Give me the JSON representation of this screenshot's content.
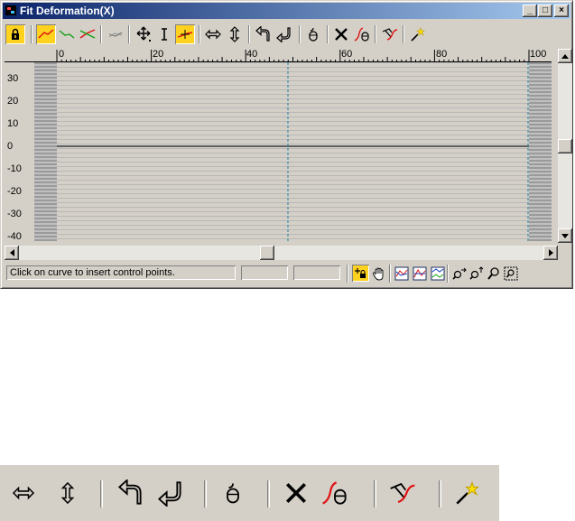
{
  "window": {
    "title": "Fit Deformation(X)",
    "controls": {
      "minimize": "_",
      "maximize": "□",
      "close": "×"
    }
  },
  "toolbar": {
    "items": [
      {
        "icon": "lock-aspect-icon",
        "active": true
      },
      {
        "icon": "display-x-axis-icon"
      },
      {
        "icon": "display-y-axis-icon"
      },
      {
        "icon": "display-xy-axes-icon"
      },
      {
        "icon": "swap-deform-curves-icon"
      },
      {
        "icon": "move-control-point-icon"
      },
      {
        "icon": "scale-control-point-icon"
      },
      {
        "icon": "insert-bezier-point-icon",
        "active": true
      },
      {
        "icon": "mirror-horizontally-icon"
      },
      {
        "icon": "mirror-vertically-icon"
      },
      {
        "icon": "rotate-90-ccw-icon"
      },
      {
        "icon": "rotate-90-cw-icon"
      },
      {
        "icon": "delete-control-point-icon"
      },
      {
        "icon": "reset-curve-icon"
      },
      {
        "icon": "delete-curve-icon"
      },
      {
        "icon": "get-shape-icon"
      },
      {
        "icon": "generate-path-icon"
      }
    ]
  },
  "graph": {
    "ruler_labels": [
      "0",
      "20",
      "40",
      "60",
      "80",
      "100"
    ],
    "y_labels": [
      "30",
      "20",
      "10",
      "0",
      "-10",
      "-20",
      "-30",
      "-40"
    ]
  },
  "statusbar": {
    "prompt": "Click on curve to insert control points.",
    "field1_value": "",
    "field2_value": "",
    "tools": [
      {
        "icon": "lock-aspect-status-icon",
        "active": true
      },
      {
        "icon": "pan-hand-icon"
      },
      {
        "icon": "zoom-extents-icon"
      },
      {
        "icon": "zoom-horizontal-extents-icon"
      },
      {
        "icon": "zoom-vertical-extents-icon"
      },
      {
        "icon": "zoom-horizontal-icon"
      },
      {
        "icon": "zoom-vertical-icon"
      },
      {
        "icon": "zoom-icon"
      },
      {
        "icon": "zoom-region-icon"
      }
    ]
  },
  "colors": {
    "title_start": "#0a246a",
    "title_end": "#a6caf0",
    "active_button": "#ffd21f",
    "face": "#d4d0c8",
    "curve_red": "#e01010",
    "curve_green": "#10a010",
    "marker_blue": "#2080a0"
  }
}
